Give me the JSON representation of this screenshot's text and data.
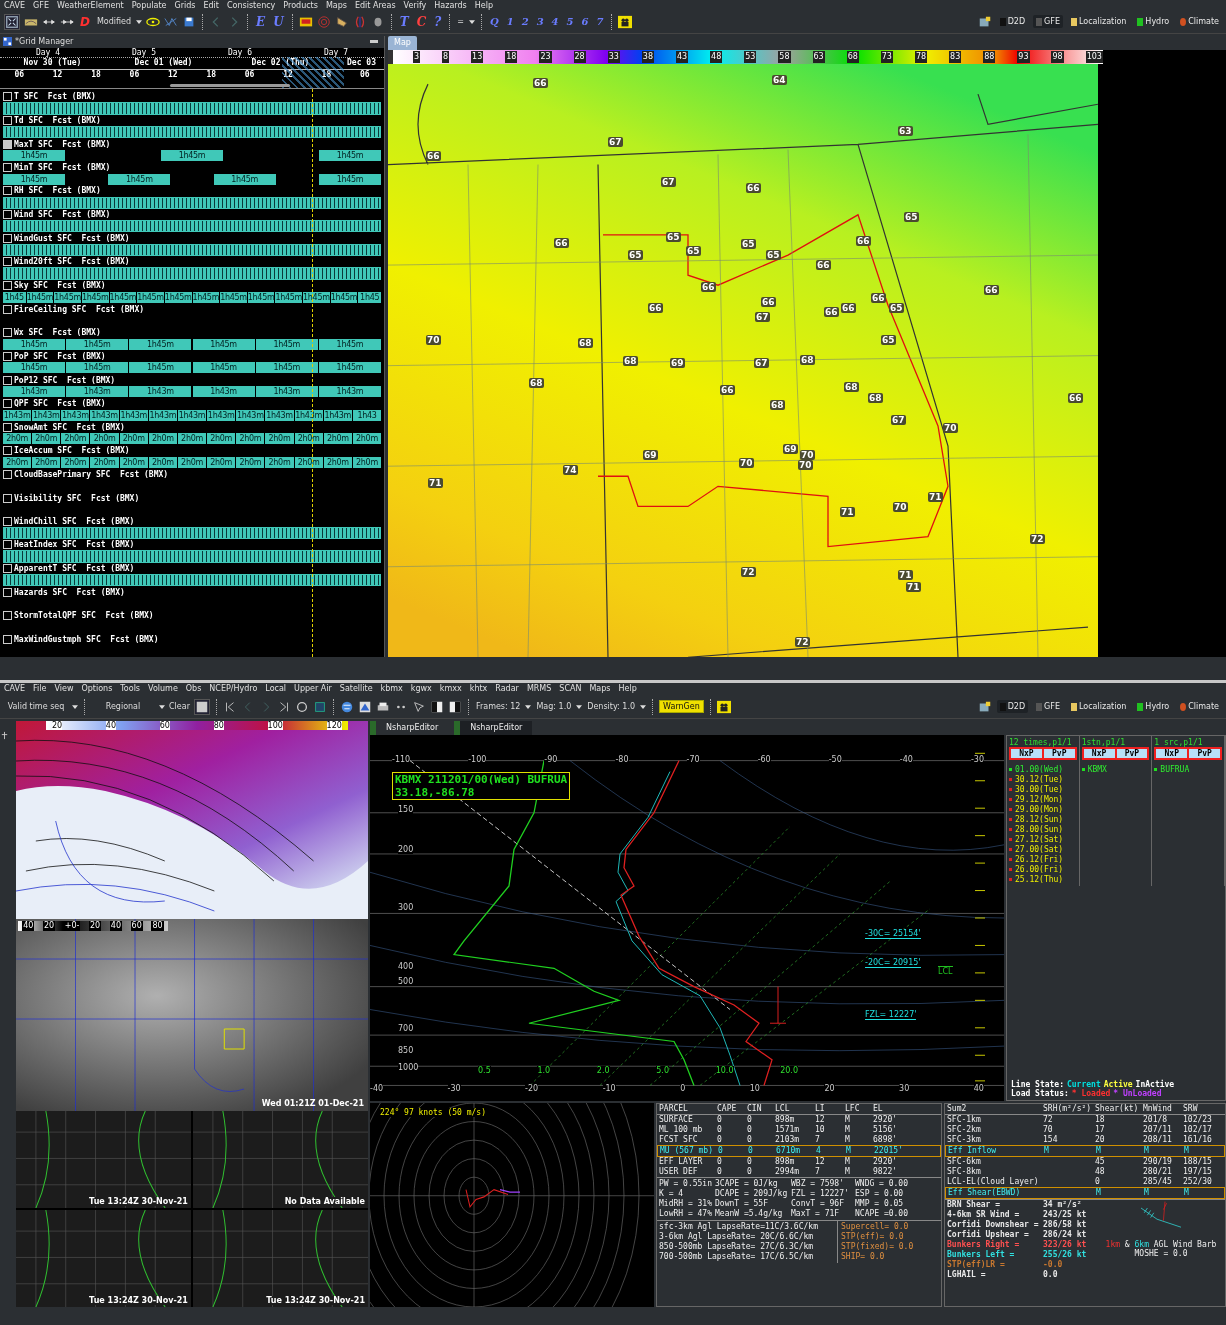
{
  "top": {
    "menu": [
      "CAVE",
      "GFE",
      "WeatherElement",
      "Populate",
      "Grids",
      "Edit",
      "Consistency",
      "Products",
      "Maps",
      "Edit Areas",
      "Verify",
      "Hazards",
      "Help"
    ],
    "toolbar": {
      "letter_d": "D",
      "mode": "Modified",
      "edit_letters": [
        "E",
        "U"
      ],
      "tc_letters": [
        {
          "text": "T",
          "color": "#6a7cff"
        },
        {
          "text": "C",
          "color": "#ff4040"
        },
        {
          "text": "?",
          "color": "#6a7cff"
        }
      ],
      "menu_eq": "=",
      "q_letters": [
        "Q",
        "1",
        "2",
        "3",
        "4",
        "5",
        "6",
        "7"
      ]
    },
    "perspectives": [
      {
        "label": "D2D",
        "selected": false
      },
      {
        "label": "GFE",
        "selected": true
      },
      {
        "label": "Localization",
        "selected": false
      },
      {
        "label": "Hydro",
        "selected": false
      },
      {
        "label": "Climate",
        "selected": false
      }
    ],
    "grid_manager": {
      "title": "*Grid Manager",
      "days": [
        "Day 4",
        "Day 5",
        "Day 6",
        "Day 7"
      ],
      "dates": [
        "Nov 30 (Tue)",
        "Dec 01 (Wed)",
        "Dec 02 (Thu)",
        "Dec 03"
      ],
      "hours": [
        "06",
        "12",
        "18",
        "06",
        "12",
        "18",
        "06",
        "12",
        "18",
        "06"
      ],
      "elements": [
        {
          "name": "T SFC  Fcst (BMX)",
          "selected": false,
          "kind": "dense"
        },
        {
          "name": "Td SFC  Fcst (BMX)",
          "selected": false,
          "kind": "dense"
        },
        {
          "name": "MaxT SFC  Fcst (BMX)",
          "selected": true,
          "kind": "blocks",
          "blocks": [
            "1h45m",
            "1h45m",
            "1h45m"
          ]
        },
        {
          "name": "MinT SFC  Fcst (BMX)",
          "selected": false,
          "kind": "blocks",
          "blocks": [
            "1h45m",
            "1h45m",
            "1h45m",
            "1h45m"
          ]
        },
        {
          "name": "RH SFC  Fcst (BMX)",
          "selected": false,
          "kind": "dense"
        },
        {
          "name": "Wind SFC  Fcst (BMX)",
          "selected": false,
          "kind": "dense"
        },
        {
          "name": "WindGust SFC  Fcst (BMX)",
          "selected": false,
          "kind": "dense"
        },
        {
          "name": "Wind20ft SFC  Fcst (BMX)",
          "selected": false,
          "kind": "dense"
        },
        {
          "name": "Sky SFC  Fcst (BMX)",
          "selected": false,
          "kind": "blocks",
          "blocks": [
            "1h45",
            "1h45m",
            "1h45m",
            "1h45m",
            "1h45m",
            "1h45m",
            "1h45m",
            "1h45m",
            "1h45m",
            "1h45m",
            "1h45m",
            "1h45m",
            "1h45m",
            "1h45"
          ]
        },
        {
          "name": "FireCeiling SFC  Fcst (BMX)",
          "selected": false,
          "kind": "empty"
        },
        {
          "name": "Wx SFC  Fcst (BMX)",
          "selected": false,
          "kind": "blocks",
          "blocks": [
            "1h45m",
            "1h45m",
            "1h45m",
            "1h45m",
            "1h45m",
            "1h45m"
          ]
        },
        {
          "name": "PoP SFC  Fcst (BMX)",
          "selected": false,
          "kind": "blocks",
          "blocks": [
            "1h45m",
            "1h45m",
            "1h45m",
            "1h45m",
            "1h45m",
            "1h45m"
          ]
        },
        {
          "name": "PoP12 SFC  Fcst (BMX)",
          "selected": false,
          "kind": "blocks",
          "blocks": [
            "1h43m",
            "1h43m",
            "1h43m",
            "1h43m",
            "1h43m",
            "1h43m"
          ]
        },
        {
          "name": "QPF SFC  Fcst (BMX)",
          "selected": false,
          "kind": "blocks",
          "blocks": [
            "1h43m",
            "1h43m",
            "1h43m",
            "1h43m",
            "1h43m",
            "1h43m",
            "1h43m",
            "1h43m",
            "1h43m",
            "1h43m",
            "1h43m",
            "1h43m",
            "1h43"
          ]
        },
        {
          "name": "SnowAmt SFC  Fcst (BMX)",
          "selected": false,
          "kind": "blocks",
          "blocks": [
            "2h0m",
            "2h0m",
            "2h0m",
            "2h0m",
            "2h0m",
            "2h0m",
            "2h0m",
            "2h0m",
            "2h0m",
            "2h0m",
            "2h0m",
            "2h0m",
            "2h0m"
          ]
        },
        {
          "name": "IceAccum SFC  Fcst (BMX)",
          "selected": false,
          "kind": "blocks",
          "blocks": [
            "2h0m",
            "2h0m",
            "2h0m",
            "2h0m",
            "2h0m",
            "2h0m",
            "2h0m",
            "2h0m",
            "2h0m",
            "2h0m",
            "2h0m",
            "2h0m",
            "2h0m"
          ]
        },
        {
          "name": "CloudBasePrimary SFC  Fcst (BMX)",
          "selected": false,
          "kind": "empty"
        },
        {
          "name": "Visibility SFC  Fcst (BMX)",
          "selected": false,
          "kind": "empty"
        },
        {
          "name": "WindChill SFC  Fcst (BMX)",
          "selected": false,
          "kind": "dense"
        },
        {
          "name": "HeatIndex SFC  Fcst (BMX)",
          "selected": false,
          "kind": "dense"
        },
        {
          "name": "ApparentT SFC  Fcst (BMX)",
          "selected": false,
          "kind": "dense"
        },
        {
          "name": "Hazards SFC  Fcst (BMX)",
          "selected": false,
          "kind": "empty"
        },
        {
          "name": "StormTotalQPF SFC  Fcst (BMX)",
          "selected": false,
          "kind": "empty"
        },
        {
          "name": "MaxWindGustmph SFC  Fcst (BMX)",
          "selected": false,
          "kind": "empty"
        }
      ]
    },
    "map": {
      "tab": "Map",
      "scale": [
        "3",
        "8",
        "13",
        "18",
        "23",
        "28",
        "33",
        "38",
        "43",
        "48",
        "53",
        "58",
        "63",
        "68",
        "73",
        "78",
        "83",
        "88",
        "93",
        "98",
        "103"
      ],
      "values": [
        "66",
        "64",
        "63",
        "67",
        "66",
        "67",
        "66",
        "65",
        "66",
        "65",
        "65",
        "65",
        "65",
        "65",
        "66",
        "66",
        "66",
        "66",
        "67",
        "66",
        "66",
        "66",
        "65",
        "66",
        "66",
        "70",
        "68",
        "65",
        "68",
        "69",
        "67",
        "68",
        "68",
        "66",
        "68",
        "68",
        "68",
        "66",
        "67",
        "70",
        "69",
        "69",
        "70",
        "70",
        "70",
        "74",
        "71",
        "71",
        "70",
        "71",
        "72",
        "72",
        "71",
        "71",
        "72"
      ]
    }
  },
  "bottom": {
    "menu": [
      "CAVE",
      "File",
      "View",
      "Options",
      "Tools",
      "Volume",
      "Obs",
      "NCEP/Hydro",
      "Local",
      "Upper Air",
      "Satellite",
      "kbmx",
      "kgwx",
      "kmxx",
      "khtx",
      "Radar",
      "MRMS",
      "SCAN",
      "Maps",
      "Help"
    ],
    "toolbar": {
      "time_mode": "Valid time seq",
      "scale": "Regional",
      "clear": "Clear",
      "frames": "Frames: 12",
      "mag": "Mag: 1.0",
      "density": "Density: 1.0",
      "warngen": "WarnGen"
    },
    "perspectives": [
      {
        "label": "D2D",
        "selected": true
      },
      {
        "label": "GFE",
        "selected": false
      },
      {
        "label": "Localization",
        "selected": false
      },
      {
        "label": "Hydro",
        "selected": false
      },
      {
        "label": "Climate",
        "selected": false
      }
    ],
    "upper_map": {
      "scale": [
        "20",
        "40",
        "60",
        "80",
        "100",
        "120"
      ]
    },
    "satellite": {
      "scale": [
        "40",
        "20",
        "+0-",
        "20",
        "40",
        "60",
        "80"
      ],
      "time": "Wed 01:21Z 01-Dec-21"
    },
    "small_maps": [
      "Tue 13:24Z 30-Nov-21",
      "No Data Available",
      "Tue 13:24Z 30-Nov-21",
      "Tue 13:24Z 30-Nov-21"
    ],
    "nsharp": {
      "tabs": [
        {
          "label": "NsharpEditor",
          "selected": false
        },
        {
          "label": "NsharpEditor",
          "selected": true
        }
      ],
      "skewt": {
        "title": "KBMX 211201/00(Wed) BUFRUA",
        "location": "33.18,-86.78",
        "top_ticks": [
          "-110",
          "-100",
          "-90",
          "-80",
          "-70",
          "-60",
          "-50",
          "-40",
          "-30"
        ],
        "bottom_ticks": [
          "-40",
          "-30",
          "-20",
          "-10",
          "0",
          "10",
          "20",
          "30",
          "40"
        ],
        "pressures": [
          "150",
          "200",
          "300",
          "400",
          "500",
          "700",
          "850",
          "1000"
        ],
        "mixing": [
          "0.5",
          "1.0",
          "2.0",
          "5.0",
          "10.0",
          "20.0"
        ],
        "levels": [
          "-30C= 25154'",
          "-20C= 20915'",
          "FZL= 12227'"
        ],
        "lcl": "LCL"
      },
      "lists": [
        {
          "header": "12 times,p1/1",
          "nav": [
            "NxP",
            "PvP"
          ],
          "items": [
            {
              "text": "01.00(Wed)",
              "selected": true
            },
            {
              "text": "30.12(Tue)",
              "selected": false
            },
            {
              "text": "30.00(Tue)",
              "selected": false
            },
            {
              "text": "29.12(Mon)",
              "selected": false
            },
            {
              "text": "29.00(Mon)",
              "selected": false
            },
            {
              "text": "28.12(Sun)",
              "selected": false
            },
            {
              "text": "28.00(Sun)",
              "selected": false
            },
            {
              "text": "27.12(Sat)",
              "selected": false
            },
            {
              "text": "27.00(Sat)",
              "selected": false
            },
            {
              "text": "26.12(Fri)",
              "selected": false
            },
            {
              "text": "26.00(Fri)",
              "selected": false
            },
            {
              "text": "25.12(Thu)",
              "selected": false
            }
          ]
        },
        {
          "header": "1stn,p1/1",
          "nav": [
            "NxP",
            "PvP"
          ],
          "items": [
            {
              "text": "KBMX",
              "selected": true
            }
          ]
        },
        {
          "header": "1 src,p1/1",
          "nav": [
            "NxP",
            "PvP"
          ],
          "items": [
            {
              "text": "BUFRUA",
              "selected": true
            }
          ]
        }
      ],
      "legend": {
        "line_label": "Line State:",
        "line_states": [
          {
            "text": "Current",
            "color": "#00e0e0"
          },
          {
            "text": "Active",
            "color": "#ffff40"
          },
          {
            "text": "InActive",
            "color": "#ffffff"
          }
        ],
        "load_label": "Load Status:",
        "load_states": [
          {
            "text": "* Loaded",
            "color": "#ff3030"
          },
          {
            "text": "* UnLoaded",
            "color": "#c040ff"
          }
        ]
      },
      "hodograph": {
        "reading": "224°  97 knots (50 m/s)"
      },
      "parcel": {
        "columns": [
          "PARCEL",
          "CAPE",
          "CIN",
          "LCL",
          "LI",
          "LFC",
          "EL"
        ],
        "rows": [
          {
            "cells": [
              "SURFACE",
              "0",
              "0",
              "898m",
              "12",
              "M",
              "2920'"
            ],
            "selected": false
          },
          {
            "cells": [
              "ML 100 mb",
              "0",
              "0",
              "1571m",
              "10",
              "M",
              "5156'"
            ],
            "selected": false
          },
          {
            "cells": [
              "FCST SFC",
              "0",
              "0",
              "2103m",
              "7",
              "M",
              "6898'"
            ],
            "selected": false
          },
          {
            "cells": [
              "MU (567 mb)",
              "0",
              "0",
              "6710m",
              "4",
              "M",
              "22015'"
            ],
            "selected": true
          },
          {
            "cells": [
              "EFF LAYER",
              "0",
              "0",
              "898m",
              "12",
              "M",
              "2920'"
            ],
            "selected": false
          },
          {
            "cells": [
              "USER DEF",
              "0",
              "0",
              "2994m",
              "7",
              "M",
              "9822'"
            ],
            "selected": false
          }
        ],
        "indices": [
          "PW = 0.55in",
          "3CAPE = 0J/kg",
          "WBZ = 7598'",
          "WNDG = 0.00",
          "K = 4",
          "DCAPE = 209J/kg",
          "FZL = 12227'",
          "ESP = 0.00",
          "MidRH = 31%",
          "DownT = 55F",
          "ConvT = 96F",
          "MMP = 0.05",
          "LowRH = 47%",
          "MeanW =5.4g/kg",
          "MaxT = 71F",
          "NCAPE =0.00"
        ],
        "lapse": [
          "sfc-3km Agl LapseRate=11C/3.6C/km",
          "3-6km Agl LapseRate= 20C/6.6C/km",
          "850-500mb LapseRate= 27C/6.3C/km",
          "700-500mb LapseRate= 17C/6.5C/km"
        ],
        "severe": [
          "Supercell=  0.0",
          "STP(eff)=  0.0",
          "STP(fixed)= 0.0",
          "SHIP=      0.0"
        ]
      },
      "sum2": {
        "columns": [
          "Sum2",
          "SRH(m²/s²)",
          "Shear(kt)",
          "MnWind",
          "SRW"
        ],
        "rows": [
          {
            "cells": [
              "SFC-1km",
              "72",
              "18",
              "201/8",
              "102/23"
            ],
            "selected": false
          },
          {
            "cells": [
              "SFC-2km",
              "70",
              "17",
              "207/11",
              "102/17"
            ],
            "selected": false
          },
          {
            "cells": [
              "SFC-3km",
              "154",
              "20",
              "208/11",
              "161/16"
            ],
            "selected": false
          },
          {
            "cells": [
              "Eff Inflow",
              "M",
              "M",
              "M",
              "M"
            ],
            "selected": true
          },
          {
            "cells": [
              "SFC-6km",
              "",
              "45",
              "290/19",
              "188/15"
            ],
            "selected": false
          },
          {
            "cells": [
              "SFC-8km",
              "",
              "48",
              "280/21",
              "197/15"
            ],
            "selected": false
          },
          {
            "cells": [
              "LCL-EL(Cloud Layer)",
              "",
              "0",
              "285/45",
              "252/30"
            ],
            "selected": false
          },
          {
            "cells": [
              "Eff Shear(EBWD)",
              "",
              "M",
              "M",
              "M"
            ],
            "selected": true
          }
        ],
        "params": [
          {
            "label": "BRN Shear =",
            "value": "34 m²/s²",
            "color": "#e8e8e8"
          },
          {
            "label": "4-6km SR Wind =",
            "value": "243/25 kt",
            "color": "#e8e8e8"
          },
          {
            "label": "Corfidi Downshear =",
            "value": "286/58 kt",
            "color": "#e8e8e8"
          },
          {
            "label": "Corfidi Upshear =",
            "value": "286/24 kt",
            "color": "#e8e8e8"
          },
          {
            "label": "Bunkers Right =",
            "value": "323/26 kt",
            "color": "#ff5050"
          },
          {
            "label": "Bunkers Left =",
            "value": "255/26 kt",
            "color": "#30e0e0"
          },
          {
            "label": "STP(eff)LR =",
            "value": "-0.0",
            "color": "#c87830"
          },
          {
            "label": "LGHAIL =",
            "value": "0.0",
            "color": "#e8e8e8"
          }
        ],
        "barb_label": "**1km** & *6km* AGL Wind Barb",
        "moshe": "MOSHE = 0.0"
      }
    }
  }
}
